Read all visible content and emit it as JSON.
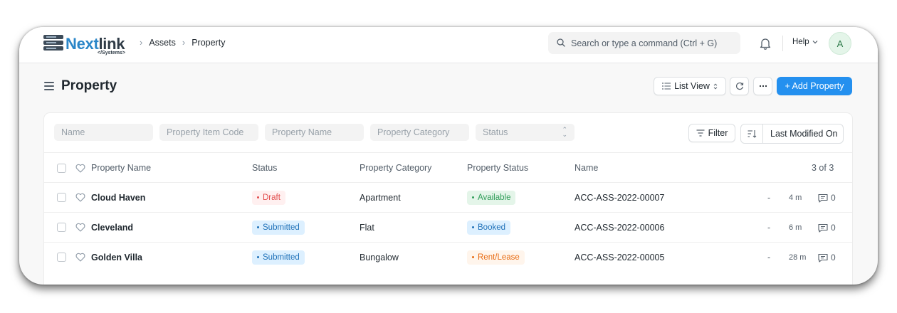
{
  "app": {
    "logo_main": "Next",
    "logo_accent": "link",
    "logo_sub": "</Systems>"
  },
  "breadcrumb": [
    "Assets",
    "Property"
  ],
  "search": {
    "placeholder": "Search or type a command (Ctrl + G)"
  },
  "navbar": {
    "help_label": "Help",
    "avatar_initial": "A"
  },
  "page": {
    "title": "Property",
    "list_view_label": "List View",
    "add_button_label": "+ Add Property"
  },
  "filters": {
    "name_placeholder": "Name",
    "item_code_placeholder": "Property Item Code",
    "property_name_placeholder": "Property Name",
    "category_placeholder": "Property Category",
    "status_placeholder": "Status",
    "filter_label": "Filter",
    "sort_label": "Last Modified On"
  },
  "table": {
    "headers": {
      "property_name": "Property Name",
      "status": "Status",
      "category": "Property Category",
      "property_status": "Property Status",
      "name": "Name",
      "count": "3 of 3"
    },
    "rows": [
      {
        "property_name": "Cloud Haven",
        "status": "Draft",
        "category": "Apartment",
        "property_status": "Available",
        "name": "ACC-ASS-2022-00007",
        "dash": "-",
        "modified": "4 m",
        "comments": "0"
      },
      {
        "property_name": "Cleveland",
        "status": "Submitted",
        "category": "Flat",
        "property_status": "Booked",
        "name": "ACC-ASS-2022-00006",
        "dash": "-",
        "modified": "6 m",
        "comments": "0"
      },
      {
        "property_name": "Golden Villa",
        "status": "Submitted",
        "category": "Bungalow",
        "property_status": "Rent/Lease",
        "name": "ACC-ASS-2022-00005",
        "dash": "-",
        "modified": "28 m",
        "comments": "0"
      }
    ]
  },
  "colors": {
    "primary": "#2490ef",
    "draft_bg": "#fff0f0",
    "draft_text": "#e24c4c",
    "submitted_bg": "#ddf0ff",
    "submitted_text": "#1e70b8",
    "available_bg": "#e4f5e9",
    "available_text": "#2f9d58",
    "booked_bg": "#ddf0ff",
    "booked_text": "#1e70b8",
    "rent_bg": "#fff5ec",
    "rent_text": "#e86c13"
  },
  "icons": [
    "search-icon",
    "bell-icon",
    "chevron-down-icon",
    "hamburger-icon",
    "list-icon",
    "refresh-icon",
    "more-icon",
    "filter-icon",
    "sort-icon",
    "heart-icon",
    "comment-icon"
  ]
}
